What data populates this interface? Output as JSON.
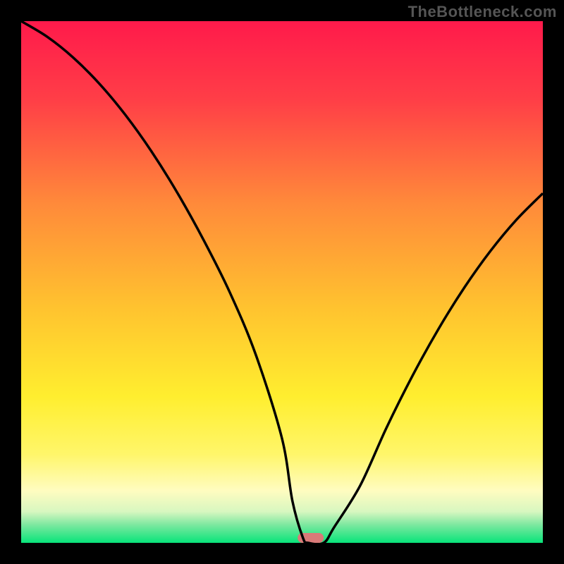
{
  "attribution": "TheBottleneck.com",
  "chart_data": {
    "type": "line",
    "title": "",
    "xlabel": "",
    "ylabel": "",
    "xlim": [
      0,
      100
    ],
    "ylim": [
      0,
      100
    ],
    "x": [
      0,
      5,
      10,
      15,
      20,
      25,
      30,
      35,
      40,
      45,
      50,
      52,
      54,
      55,
      58,
      60,
      65,
      70,
      75,
      80,
      85,
      90,
      95,
      100
    ],
    "values": [
      100,
      97,
      93,
      88,
      82,
      75,
      67,
      58,
      48,
      36,
      20,
      8,
      1,
      0,
      0,
      3,
      11,
      22,
      32,
      41,
      49,
      56,
      62,
      67
    ],
    "marker": {
      "x_start": 53,
      "x_end": 58,
      "y": 0
    },
    "background": {
      "type": "vertical_gradient",
      "stops": [
        {
          "pos": 0.0,
          "color": "#ff1a4b"
        },
        {
          "pos": 0.15,
          "color": "#ff3e47"
        },
        {
          "pos": 0.35,
          "color": "#ff8a3a"
        },
        {
          "pos": 0.55,
          "color": "#ffc32f"
        },
        {
          "pos": 0.72,
          "color": "#ffee2f"
        },
        {
          "pos": 0.83,
          "color": "#fff66a"
        },
        {
          "pos": 0.9,
          "color": "#fffcc0"
        },
        {
          "pos": 0.94,
          "color": "#d8f7c0"
        },
        {
          "pos": 0.965,
          "color": "#7ee8a0"
        },
        {
          "pos": 1.0,
          "color": "#08e47a"
        }
      ]
    },
    "marker_color": "#d97a78",
    "curve_color": "#000000"
  }
}
